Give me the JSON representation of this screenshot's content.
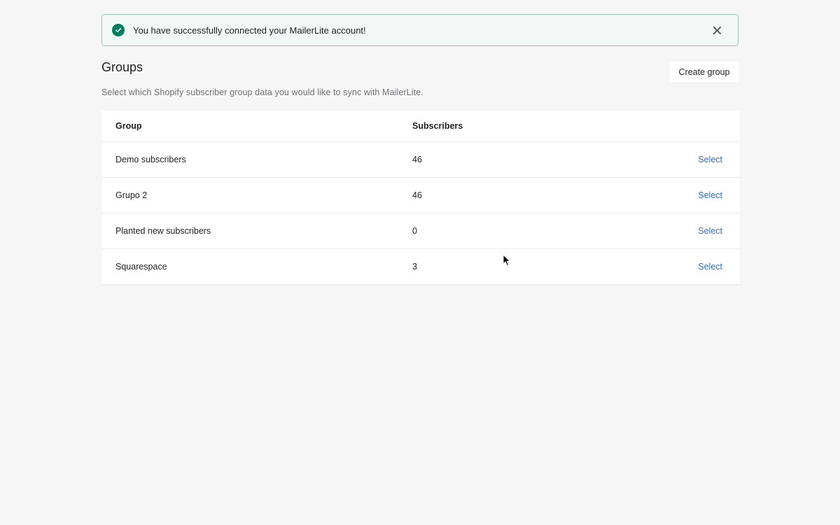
{
  "banner": {
    "message": "You have successfully connected your MailerLite account!",
    "icon": "check-circle-icon",
    "close_icon": "close-icon",
    "accent_color": "#007f5f"
  },
  "header": {
    "title": "Groups",
    "create_button_label": "Create group",
    "subtitle": "Select which Shopify subscriber group data you would like to sync with MailerLite."
  },
  "table": {
    "columns": [
      "Group",
      "Subscribers",
      ""
    ],
    "rows": [
      {
        "group": "Demo subscribers",
        "subscribers": "46",
        "action": "Select"
      },
      {
        "group": "Grupo 2",
        "subscribers": "46",
        "action": "Select"
      },
      {
        "group": "Planted new subscribers",
        "subscribers": "0",
        "action": "Select"
      },
      {
        "group": "Squarespace",
        "subscribers": "3",
        "action": "Select"
      }
    ],
    "link_color": "#2c6ecb"
  }
}
